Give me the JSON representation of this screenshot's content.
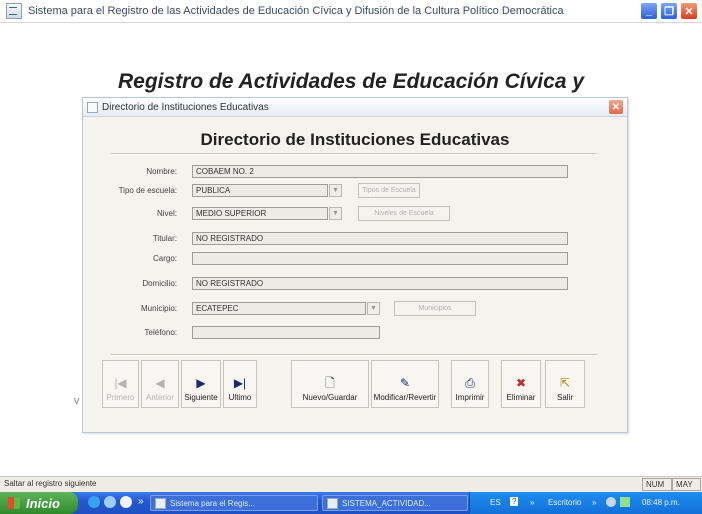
{
  "window": {
    "title": "Sistema para el Registro de las Actividades de Educación Cívica y Difusión de la Cultura Político Democrática"
  },
  "heading": "Registro de Actividades de Educación Cívica y",
  "side_letter": "v",
  "dialog": {
    "title": "Directorio de Instituciones Educativas",
    "form_title": "Directorio de Instituciones Educativas",
    "fields": {
      "nombre": {
        "label": "Nombre:",
        "value": "COBAEM NO. 2"
      },
      "tipo_escuela": {
        "label": "Tipo de escuela:",
        "value": "PUBLICA",
        "button": "Tipos de Escuela"
      },
      "nivel": {
        "label": "Nivel:",
        "value": "MEDIO SUPERIOR",
        "button": "Niveles de Escuela"
      },
      "titular": {
        "label": "Titular:",
        "value": "NO REGISTRADO"
      },
      "cargo": {
        "label": "Cargo:",
        "value": ""
      },
      "domicilio": {
        "label": "Domicilio:",
        "value": "NO REGISTRADO"
      },
      "municipio": {
        "label": "Municipio:",
        "value": "ECATEPEC",
        "button": "Municipios"
      },
      "telefono": {
        "label": "Teléfono:",
        "value": ""
      }
    },
    "toolbar": {
      "primero": "Primero",
      "anterior": "Anterior",
      "siguiente": "Siguiente",
      "ultimo": "Ultimo",
      "nuevo": "Nuevo/Guardar",
      "modificar": "Modificar/Revertir",
      "imprimir": "Imprimir",
      "eliminar": "Eliminar",
      "salir": "Salir"
    }
  },
  "status_bar": {
    "text": "Saltar al registro siguiente",
    "num": "NUM",
    "may": "MAY"
  },
  "taskbar": {
    "start": "Inicio",
    "chevron": "»",
    "tasks": [
      "Sistema para el Regis...",
      "SISTEMA_ACTIVIDAD..."
    ],
    "lang": "ES",
    "help": "?",
    "desktop": "Escritorio",
    "clock": "08:48 p.m."
  },
  "colors": {
    "taskbar": "#2458d0",
    "start": "#3a9a34",
    "close": "#d8401c"
  }
}
